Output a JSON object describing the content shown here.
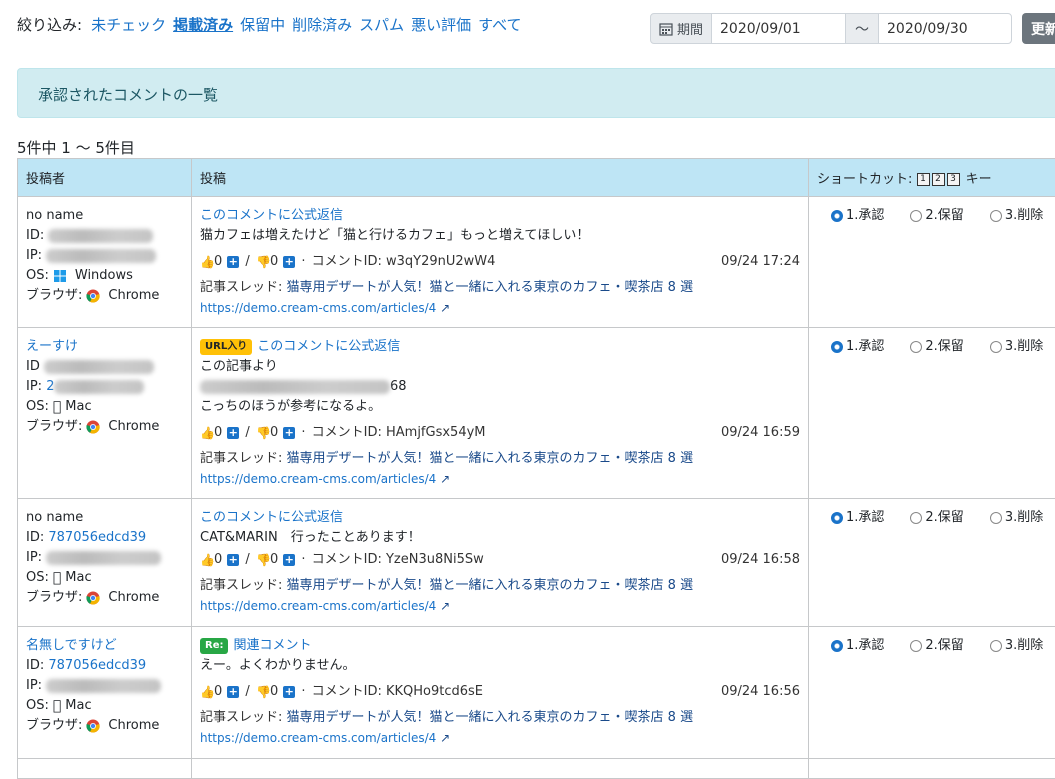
{
  "filter": {
    "label": "絞り込み:",
    "links": [
      "未チェック",
      "掲載済み",
      "保留中",
      "削除済み",
      "スパム",
      "悪い評価",
      "すべて"
    ],
    "active_index": 1
  },
  "period": {
    "label": "期間",
    "from": "2020/09/01",
    "separator": "〜",
    "to": "2020/09/30",
    "button": "更新"
  },
  "alert": "承認されたコメントの一覧",
  "count": "5件中 1 〜 5件目",
  "table": {
    "headers": [
      "投稿者",
      "投稿",
      "ショートカット:"
    ],
    "shortcut_keys": [
      "1",
      "2",
      "3"
    ],
    "shortcut_suffix": "キー",
    "radio_labels": [
      "1.承認",
      "2.保留",
      "3.削除"
    ],
    "rows": [
      {
        "author": "no name",
        "id_label": "ID:",
        "ip_label": "IP:",
        "os": "Windows",
        "browser": "Chrome",
        "reply_link": "このコメントに公式返信",
        "badge": "",
        "body": [
          "猫カフェは増えたけど「猫と行けるカフェ」もっと増えてほしい！"
        ],
        "likes": "0",
        "dislikes": "0",
        "comment_id": "コメントID: w3qY29nU2wW4",
        "time": "09/24 17:24",
        "thread_label": "記事スレッド:",
        "thread_title": "猫専用デザートが人気！猫と一緒に入れる東京のカフェ・喫茶店 8 選",
        "thread_url": "https://demo.cream-cms.com/articles/4"
      },
      {
        "author": "えーすけ",
        "id_label": "ID",
        "ip_label": "IP:",
        "ip_prefix": "2",
        "os": "Mac",
        "browser": "Chrome",
        "reply_link": "このコメントに公式返信",
        "badge": "URL入り",
        "body": [
          "この記事より",
          "68",
          "こっちのほうが参考になるよ。"
        ],
        "likes": "0",
        "dislikes": "0",
        "comment_id": "コメントID: HAmjfGsx54yM",
        "time": "09/24 16:59",
        "thread_label": "記事スレッド:",
        "thread_title": "猫専用デザートが人気！猫と一緒に入れる東京のカフェ・喫茶店 8 選",
        "thread_url": "https://demo.cream-cms.com/articles/4"
      },
      {
        "author": "no name",
        "id_label": "ID:",
        "id_value": "787056edcd39",
        "ip_label": "IP:",
        "os": "Mac",
        "browser": "Chrome",
        "reply_link": "このコメントに公式返信",
        "badge": "",
        "body": [
          "CAT&MARIN　行ったことあります！"
        ],
        "likes": "0",
        "dislikes": "0",
        "comment_id": "コメントID: YzeN3u8Ni5Sw",
        "time": "09/24 16:58",
        "thread_label": "記事スレッド:",
        "thread_title": "猫専用デザートが人気！猫と一緒に入れる東京のカフェ・喫茶店 8 選",
        "thread_url": "https://demo.cream-cms.com/articles/4"
      },
      {
        "author": "名無しですけど",
        "id_label": "ID:",
        "id_value": "787056edcd39",
        "ip_label": "IP:",
        "os": "Mac",
        "browser": "Chrome",
        "reply_link": "関連コメント",
        "badge": "Re:",
        "body": [
          "えー。よくわかりません。"
        ],
        "likes": "0",
        "dislikes": "0",
        "comment_id": "コメントID: KKQHo9tcd6sE",
        "time": "09/24 16:56",
        "thread_label": "記事スレッド:",
        "thread_title": "猫専用デザートが人気！猫と一緒に入れる東京のカフェ・喫茶店 8 選",
        "thread_url": "https://demo.cream-cms.com/articles/4"
      }
    ]
  },
  "labels": {
    "os": "OS:",
    "browser": "ブラウザ:"
  }
}
